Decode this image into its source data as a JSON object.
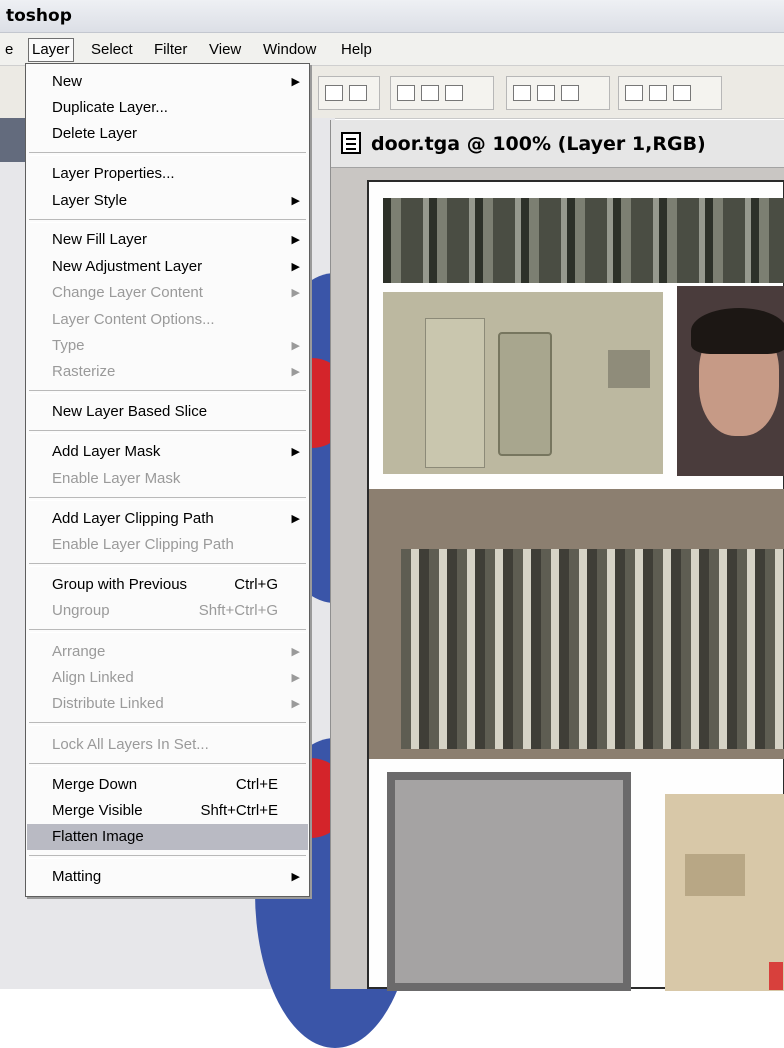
{
  "app": {
    "title": "toshop"
  },
  "menubar": {
    "items": [
      "e",
      "Layer",
      "Select",
      "Filter",
      "View",
      "Window",
      "Help"
    ]
  },
  "document": {
    "title": "door.tga @ 100% (Layer 1,RGB)"
  },
  "layer_menu": {
    "items": [
      {
        "label": "New",
        "submenu": true,
        "enabled": true
      },
      {
        "label": "Duplicate Layer...",
        "enabled": true
      },
      {
        "label": "Delete Layer",
        "enabled": true
      },
      {
        "label": "Layer Properties...",
        "enabled": true
      },
      {
        "label": "Layer Style",
        "submenu": true,
        "enabled": true
      },
      {
        "label": "New Fill Layer",
        "submenu": true,
        "enabled": true
      },
      {
        "label": "New Adjustment Layer",
        "submenu": true,
        "enabled": true
      },
      {
        "label": "Change Layer Content",
        "submenu": true,
        "enabled": false
      },
      {
        "label": "Layer Content Options...",
        "enabled": false
      },
      {
        "label": "Type",
        "submenu": true,
        "enabled": false
      },
      {
        "label": "Rasterize",
        "submenu": true,
        "enabled": false
      },
      {
        "label": "New Layer Based Slice",
        "enabled": true
      },
      {
        "label": "Add Layer Mask",
        "submenu": true,
        "enabled": true
      },
      {
        "label": "Enable Layer Mask",
        "enabled": false
      },
      {
        "label": "Add Layer Clipping Path",
        "submenu": true,
        "enabled": true
      },
      {
        "label": "Enable Layer Clipping Path",
        "enabled": false
      },
      {
        "label": "Group with Previous",
        "shortcut": "Ctrl+G",
        "enabled": true
      },
      {
        "label": "Ungroup",
        "shortcut": "Shft+Ctrl+G",
        "enabled": false
      },
      {
        "label": "Arrange",
        "submenu": true,
        "enabled": false
      },
      {
        "label": "Align Linked",
        "submenu": true,
        "enabled": false
      },
      {
        "label": "Distribute Linked",
        "submenu": true,
        "enabled": false
      },
      {
        "label": "Lock All Layers In Set...",
        "enabled": false
      },
      {
        "label": "Merge Down",
        "shortcut": "Ctrl+E",
        "enabled": true
      },
      {
        "label": "Merge Visible",
        "shortcut": "Shft+Ctrl+E",
        "enabled": true
      },
      {
        "label": "Flatten Image",
        "enabled": true,
        "highlighted": true
      },
      {
        "label": "Matting",
        "submenu": true,
        "enabled": true
      }
    ]
  },
  "icons": {
    "submenu_arrow": "▶"
  },
  "colors": {
    "menu_highlight": "#b9bac3",
    "disabled_text": "#9a9a9a",
    "accent_blue": "#3a55a8",
    "accent_red": "#d4242a"
  }
}
